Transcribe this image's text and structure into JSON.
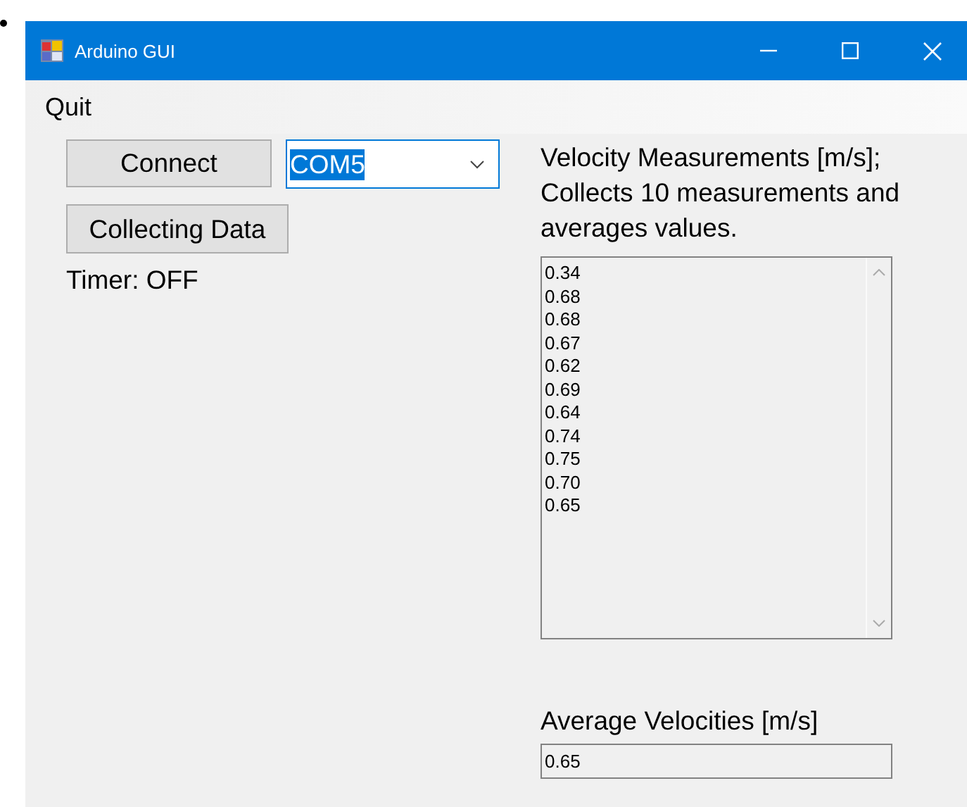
{
  "window": {
    "title": "Arduino GUI"
  },
  "menu": [
    "Quit"
  ],
  "connect_button": "Connect",
  "port_combo": {
    "value": "COM5",
    "text_selected": true
  },
  "collect_button": "Collecting Data",
  "timer_label": "Timer: OFF",
  "measurements": {
    "label": "Velocity Measurements [m/s]; Collects 10 measurements and averages values.",
    "values": [
      "0.34",
      "0.68",
      "0.68",
      "0.67",
      "0.62",
      "0.69",
      "0.64",
      "0.74",
      "0.75",
      "0.70",
      "0.65"
    ]
  },
  "average": {
    "label": "Average Velocities [m/s]",
    "value": "0.65"
  }
}
